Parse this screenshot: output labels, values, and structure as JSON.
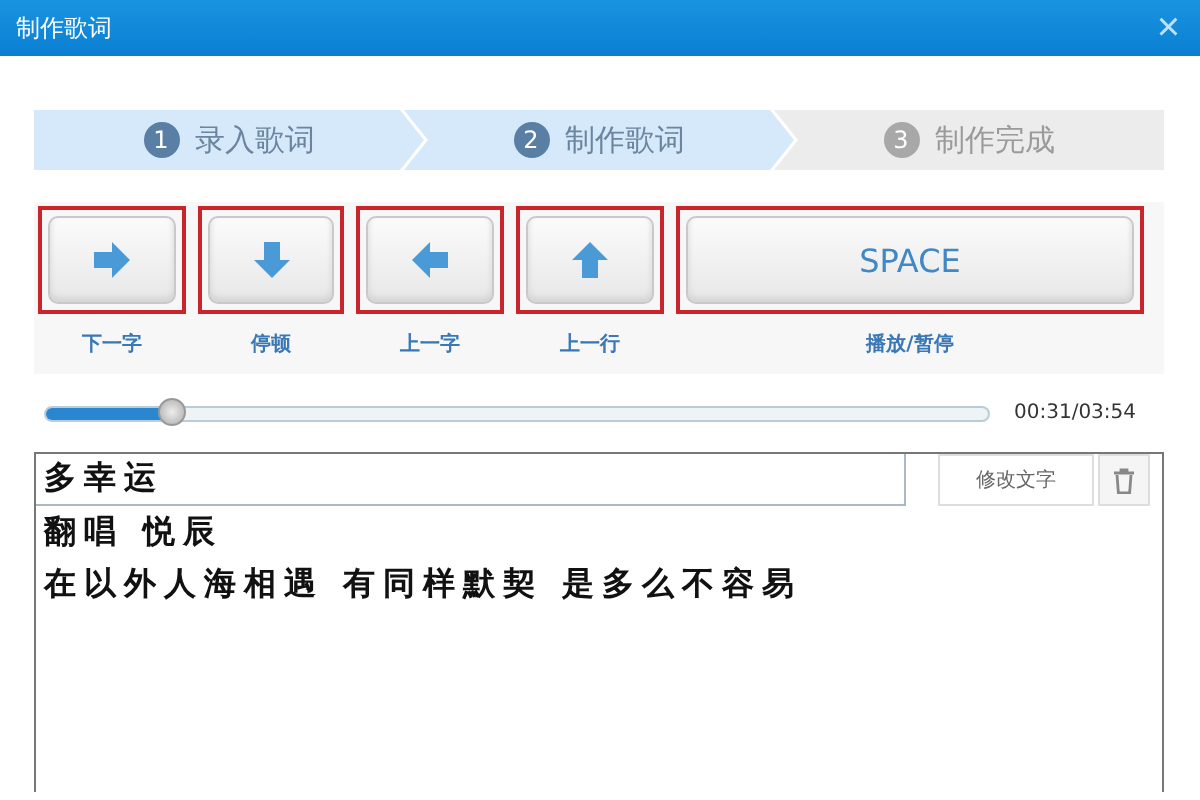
{
  "window": {
    "title": "制作歌词",
    "close": "×"
  },
  "steps": [
    {
      "number": "1",
      "label": "录入歌词",
      "active": true
    },
    {
      "number": "2",
      "label": "制作歌词",
      "active": true
    },
    {
      "number": "3",
      "label": "制作完成",
      "active": false
    }
  ],
  "keys": [
    {
      "kind": "right",
      "caption": "下一字",
      "highlighted": true
    },
    {
      "kind": "down",
      "caption": "停顿",
      "highlighted": true
    },
    {
      "kind": "left",
      "caption": "上一字",
      "highlighted": true
    },
    {
      "kind": "up",
      "caption": "上一行",
      "highlighted": true
    },
    {
      "kind": "space",
      "text": "SPACE",
      "caption": "播放/暂停",
      "highlighted": true
    }
  ],
  "progress": {
    "level": 0.133,
    "time": "00:31/03:54"
  },
  "editor": {
    "current_line": "多幸运",
    "edit_button": "修改文字",
    "lines": [
      "翻唱 悦辰",
      "在以外人海相遇 有同样默契 是多么不容易"
    ]
  }
}
